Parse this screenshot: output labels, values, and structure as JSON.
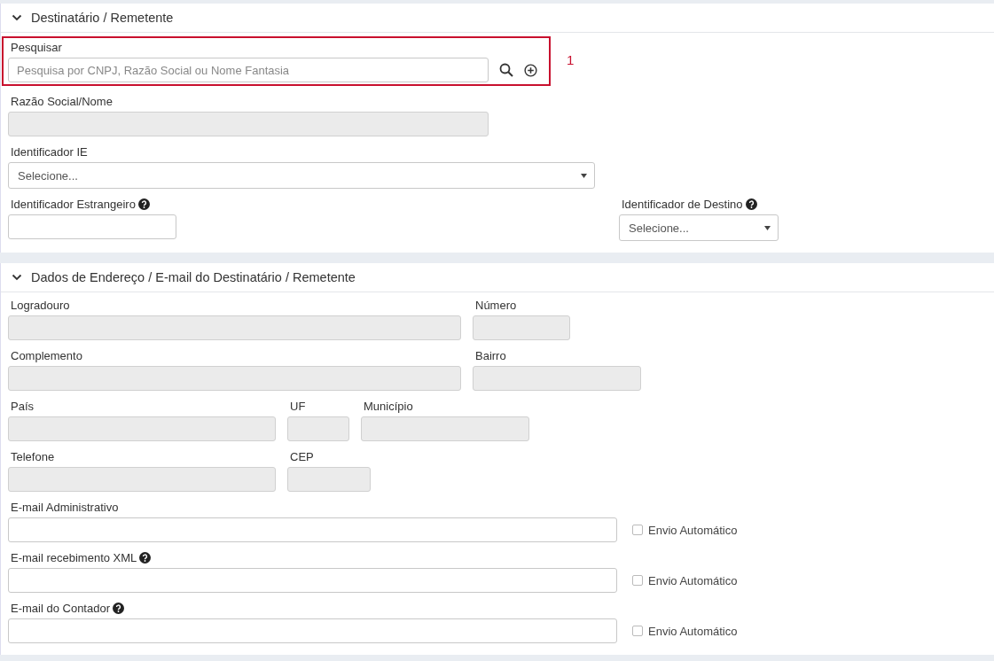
{
  "sections": [
    {
      "title": "Destinatário / Remetente",
      "expanded": true,
      "rows": [
        {
          "fields": [
            {
              "kind": "search",
              "label": "Pesquisar",
              "placeholder": "Pesquisa por CNPJ, Razão Social ou Nome Fantasia",
              "disabled": false,
              "highlighted": true,
              "callout": "1"
            }
          ]
        },
        {
          "fields": [
            {
              "kind": "text",
              "label": "Razão Social/Nome",
              "disabled": true
            }
          ]
        },
        {
          "fields": [
            {
              "kind": "select",
              "label": "Identificador IE",
              "value": "Selecione...",
              "disabled": false
            }
          ]
        },
        {
          "fields": [
            {
              "kind": "text",
              "label": "Identificador Estrangeiro",
              "disabled": false,
              "help": true
            },
            {
              "kind": "select",
              "label": "Identificador de Destino",
              "value": "Selecione...",
              "disabled": false,
              "help": true
            }
          ]
        }
      ]
    },
    {
      "title": "Dados de Endereço / E-mail do Destinatário / Remetente",
      "expanded": true,
      "rows": [
        {
          "fields": [
            {
              "kind": "text",
              "label": "Logradouro",
              "disabled": true
            },
            {
              "kind": "text",
              "label": "Número",
              "disabled": true
            }
          ]
        },
        {
          "fields": [
            {
              "kind": "text",
              "label": "Complemento",
              "disabled": true
            },
            {
              "kind": "text",
              "label": "Bairro",
              "disabled": true
            }
          ]
        },
        {
          "fields": [
            {
              "kind": "text",
              "label": "País",
              "disabled": true
            },
            {
              "kind": "text",
              "label": "UF",
              "disabled": true
            },
            {
              "kind": "text",
              "label": "Município",
              "disabled": true
            }
          ]
        },
        {
          "fields": [
            {
              "kind": "text",
              "label": "Telefone",
              "disabled": true
            },
            {
              "kind": "text",
              "label": "CEP",
              "disabled": true
            }
          ]
        },
        {
          "fields": [
            {
              "kind": "email",
              "label": "E-mail Administrativo",
              "disabled": false,
              "checkbox": {
                "label": "Envio Automático",
                "checked": false
              }
            }
          ]
        },
        {
          "fields": [
            {
              "kind": "email",
              "label": "E-mail recebimento XML",
              "disabled": false,
              "help": true,
              "checkbox": {
                "label": "Envio Automático",
                "checked": false
              }
            }
          ]
        },
        {
          "fields": [
            {
              "kind": "email",
              "label": "E-mail do Contador",
              "disabled": false,
              "help": true,
              "checkbox": {
                "label": "Envio Automático",
                "checked": false
              }
            }
          ]
        }
      ]
    }
  ]
}
